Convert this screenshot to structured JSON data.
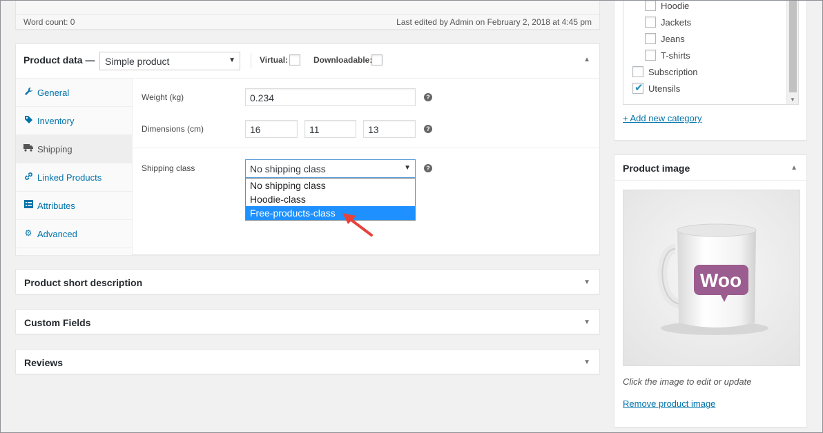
{
  "editor": {
    "word_count": "Word count: 0",
    "last_edited": "Last edited by Admin on February 2, 2018 at 4:45 pm"
  },
  "product_data": {
    "title": "Product data —",
    "type_selected": "Simple product",
    "virtual_label": "Virtual:",
    "downloadable_label": "Downloadable:",
    "tabs": [
      {
        "label": "General",
        "icon": "wrench-icon"
      },
      {
        "label": "Inventory",
        "icon": "tag-icon"
      },
      {
        "label": "Shipping",
        "icon": "truck-icon"
      },
      {
        "label": "Linked Products",
        "icon": "link-icon"
      },
      {
        "label": "Attributes",
        "icon": "list-icon"
      },
      {
        "label": "Advanced",
        "icon": "gear-icon"
      }
    ],
    "active_tab": "Shipping",
    "shipping": {
      "weight_label": "Weight (kg)",
      "weight_value": "0.234",
      "dimensions_label": "Dimensions (cm)",
      "length": "16",
      "width": "11",
      "height": "13",
      "class_label": "Shipping class",
      "class_selected": "No shipping class",
      "class_options": [
        "No shipping class",
        "Hoodie-class",
        "Free-products-class"
      ],
      "highlighted_option": "Free-products-class"
    }
  },
  "collapsed_boxes": [
    "Product short description",
    "Custom Fields",
    "Reviews"
  ],
  "categories": {
    "items": [
      {
        "label": "Hoodie",
        "checked": false,
        "child": true
      },
      {
        "label": "Jackets",
        "checked": false,
        "child": true
      },
      {
        "label": "Jeans",
        "checked": false,
        "child": true
      },
      {
        "label": "T-shirts",
        "checked": false,
        "child": true
      },
      {
        "label": "Subscription",
        "checked": false,
        "child": false
      },
      {
        "label": "Utensils",
        "checked": true,
        "child": false
      }
    ],
    "add_new": "+ Add new category"
  },
  "product_image": {
    "title": "Product image",
    "badge_text": "Woo",
    "caption": "Click the image to edit or update",
    "remove": "Remove product image"
  },
  "colors": {
    "link": "#0073aa",
    "highlight": "#1e90ff",
    "woo_purple": "#9b5c8f",
    "arrow_red": "#e8413c"
  }
}
